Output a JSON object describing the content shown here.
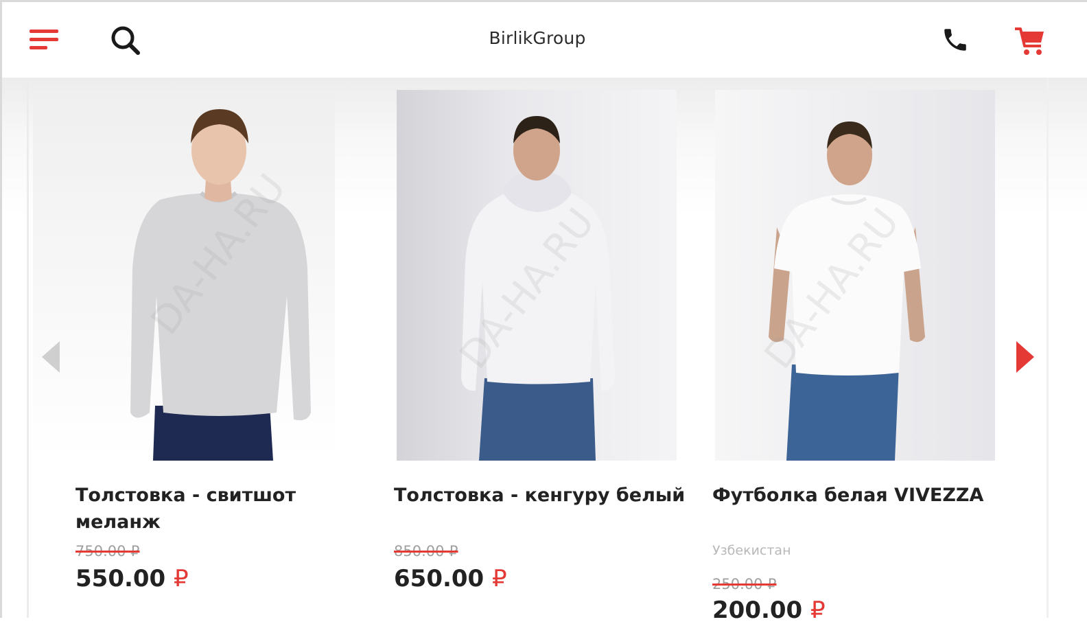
{
  "header": {
    "title": "BirlikGroup",
    "icons": [
      "menu-icon",
      "search-icon",
      "phone-icon",
      "cart-icon"
    ],
    "accent_color": "#e53935"
  },
  "carousel": {
    "products": [
      {
        "name": "Толстовка - свитшот меланж",
        "old_price": "750.00 ₽",
        "price": "550.00",
        "currency": "₽",
        "garment_color": "#d6d6d8"
      },
      {
        "name": "Толстовка - кенгуру белый",
        "old_price": "850.00 ₽",
        "price": "650.00",
        "currency": "₽",
        "garment_color": "#f3f3f6"
      },
      {
        "name": "Футболка белая VIVEZZA",
        "origin": "Узбекистан",
        "old_price": "250.00 ₽",
        "price": "200.00",
        "currency": "₽",
        "garment_color": "#fbfbfb"
      }
    ],
    "watermark": "DA-HA.RU",
    "prev_arrow_color": "#cfcfcf",
    "next_arrow_color": "#e53935"
  }
}
